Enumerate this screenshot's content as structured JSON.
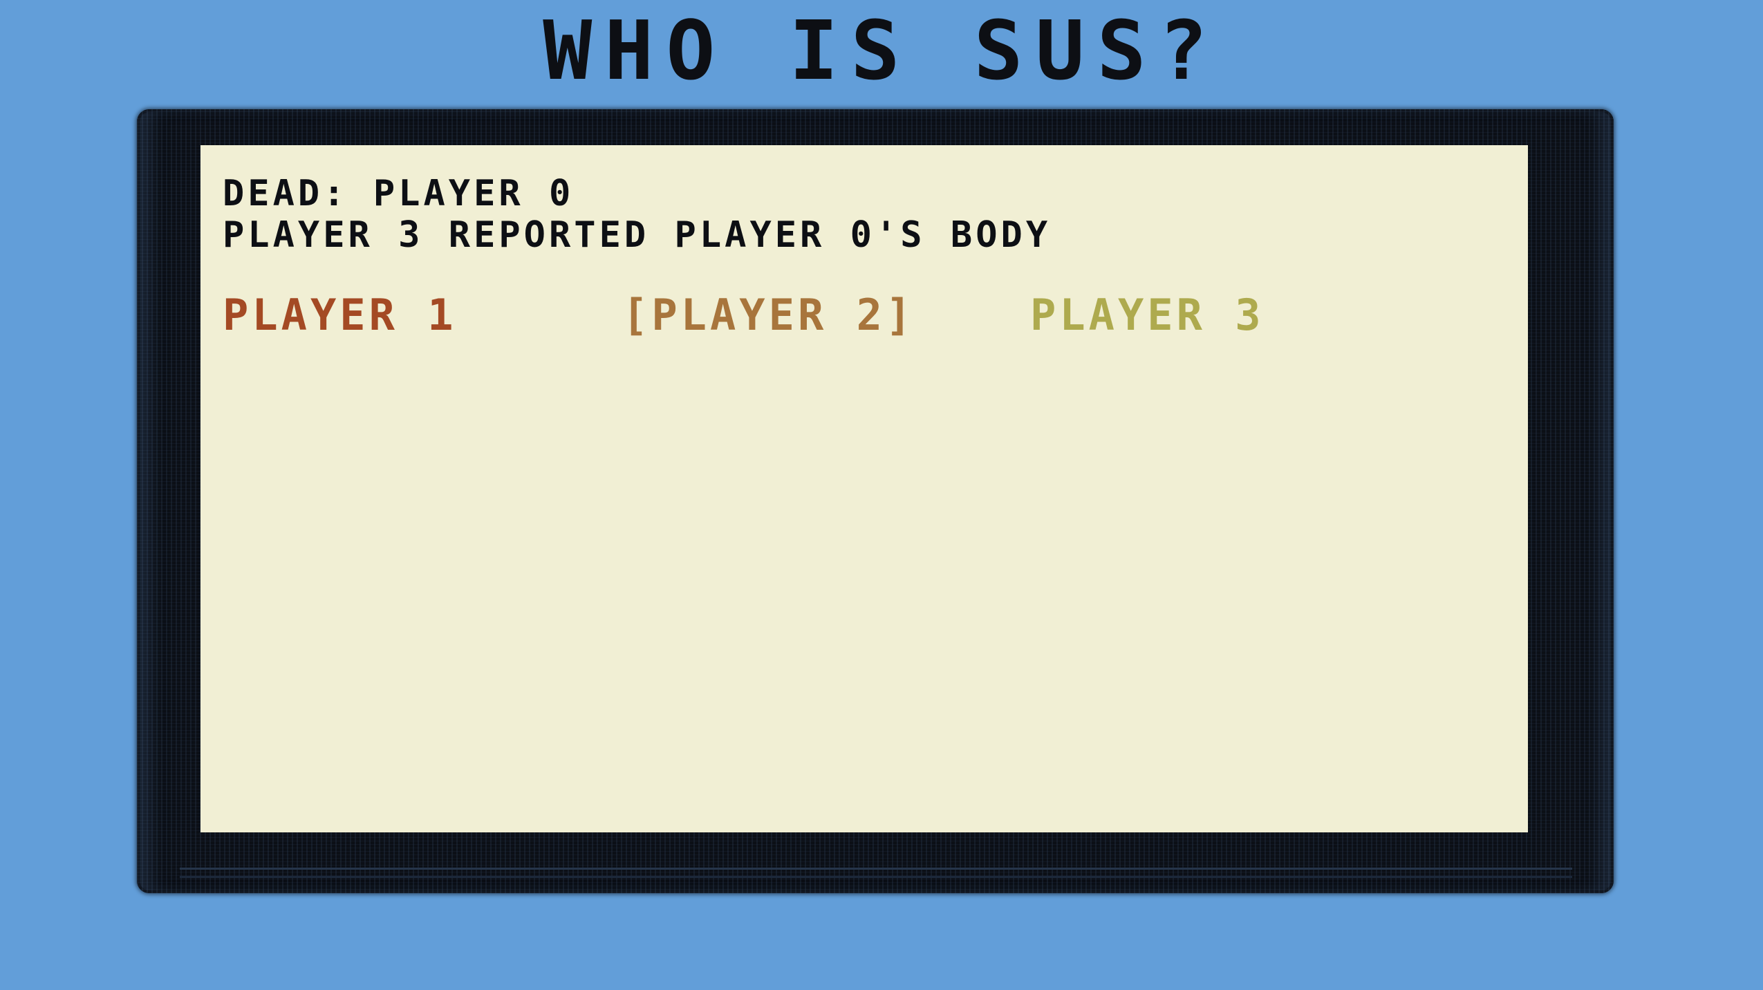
{
  "title": "WHO IS SUS?",
  "meeting": {
    "dead_text": "DEAD: PLAYER 0",
    "report_text": "PLAYER 3 REPORTED PLAYER 0'S BODY"
  },
  "vote_options": [
    {
      "label": "PLAYER 1",
      "selected": false,
      "color": "#a44a24"
    },
    {
      "label": "[PLAYER 2]",
      "selected": true,
      "color": "#a8753c"
    },
    {
      "label": "PLAYER 3",
      "selected": false,
      "color": "#aeaa4e"
    }
  ],
  "colors": {
    "background": "#629ed9",
    "screen": "#f1efd4",
    "frame": "#0b0f16",
    "text": "#0d0f14"
  }
}
